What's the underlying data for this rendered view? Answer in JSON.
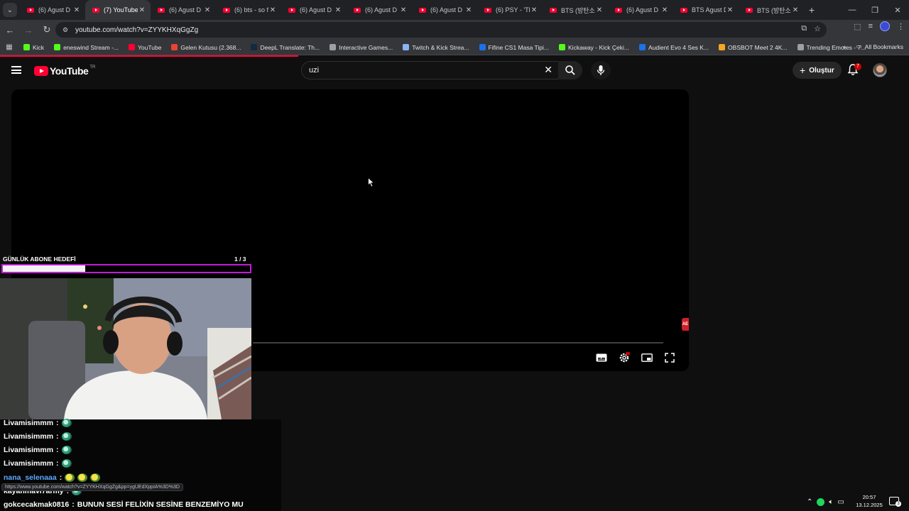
{
  "browser": {
    "tabs": [
      {
        "title": "(6) Agust D"
      },
      {
        "title": "(7) YouTube",
        "active": true
      },
      {
        "title": "(6) Agust D"
      },
      {
        "title": "(6) bts - so f"
      },
      {
        "title": "(6) Agust D"
      },
      {
        "title": "(6) Agust D"
      },
      {
        "title": "(6) Agust D"
      },
      {
        "title": "(6) PSY - 'Th"
      },
      {
        "title": "BTS (방탄소"
      },
      {
        "title": "(6) Agust D"
      },
      {
        "title": "BTS Agust D"
      },
      {
        "title": "BTS (방탄소"
      }
    ],
    "url": "youtube.com/watch?v=ZYYKHXqGgZg",
    "bookmarks": [
      {
        "label": "Kick",
        "color": "#53fc18"
      },
      {
        "label": "eneswind Stream -...",
        "color": "#53fc18"
      },
      {
        "label": "YouTube",
        "color": "#ff0033"
      },
      {
        "label": "Gelen Kutusu (2.368...",
        "color": "#ea4335"
      },
      {
        "label": "DeepL Translate: Th...",
        "color": "#0f2b46"
      },
      {
        "label": "Interactive Games...",
        "color": "#9aa0a6"
      },
      {
        "label": "Twitch & Kick Strea...",
        "color": "#8ab4f8"
      },
      {
        "label": "Fifine CS1 Masa Tipi...",
        "color": "#1a73e8"
      },
      {
        "label": "Kickaway - Kick Çeki...",
        "color": "#53fc18"
      },
      {
        "label": "Audient Evo 4 Ses K...",
        "color": "#1a73e8"
      },
      {
        "label": "OBSBOT Meet 2 4K...",
        "color": "#f5a623"
      },
      {
        "label": "Trending Emotes - 7...",
        "color": "#9aa0a6"
      }
    ],
    "all_bookmarks": "All Bookmarks"
  },
  "youtube": {
    "logo_text": "YouTube",
    "country": "TR",
    "search_value": "uzi",
    "create_label": "Oluştur",
    "notification_count": "7",
    "accent": "#ff0033"
  },
  "overlay": {
    "goal_label": "GÜNLÜK ABONE HEDEFİ",
    "goal_count": "1  / 3",
    "goal_fraction": 0.333,
    "goal_color": "#c21bd6",
    "ae_badge": "AE"
  },
  "chat": {
    "messages": [
      {
        "user": "Livamisimmm",
        "text": "",
        "emotes": [
          "earth"
        ]
      },
      {
        "user": "Livamisimmm",
        "text": "",
        "emotes": [
          "earth"
        ]
      },
      {
        "user": "Livamisimmm",
        "text": "",
        "emotes": [
          "earth"
        ]
      },
      {
        "user": "Livamisimmm",
        "text": "",
        "emotes": [
          "earth"
        ]
      },
      {
        "user": "nana_selenaaa",
        "text": "",
        "emotes": [
          "pepe",
          "pepe",
          "pepe"
        ],
        "blue": true
      },
      {
        "user": "kayanmavi7army",
        "text": "",
        "emotes": [
          "earth"
        ]
      },
      {
        "user": "gokcecakmak0816",
        "text": "BUNUN SESİ FELİXİN SESİNE BENZEMİYO MU",
        "emotes": []
      }
    ],
    "url_hint": "https://www.youtube.com/watch?v=ZYYKHXqGgZg&pp=ygUEdXppIA%3D%3D"
  },
  "taskbar": {
    "time": "20:57",
    "date": "13.12.2025",
    "notification_count": "3"
  }
}
